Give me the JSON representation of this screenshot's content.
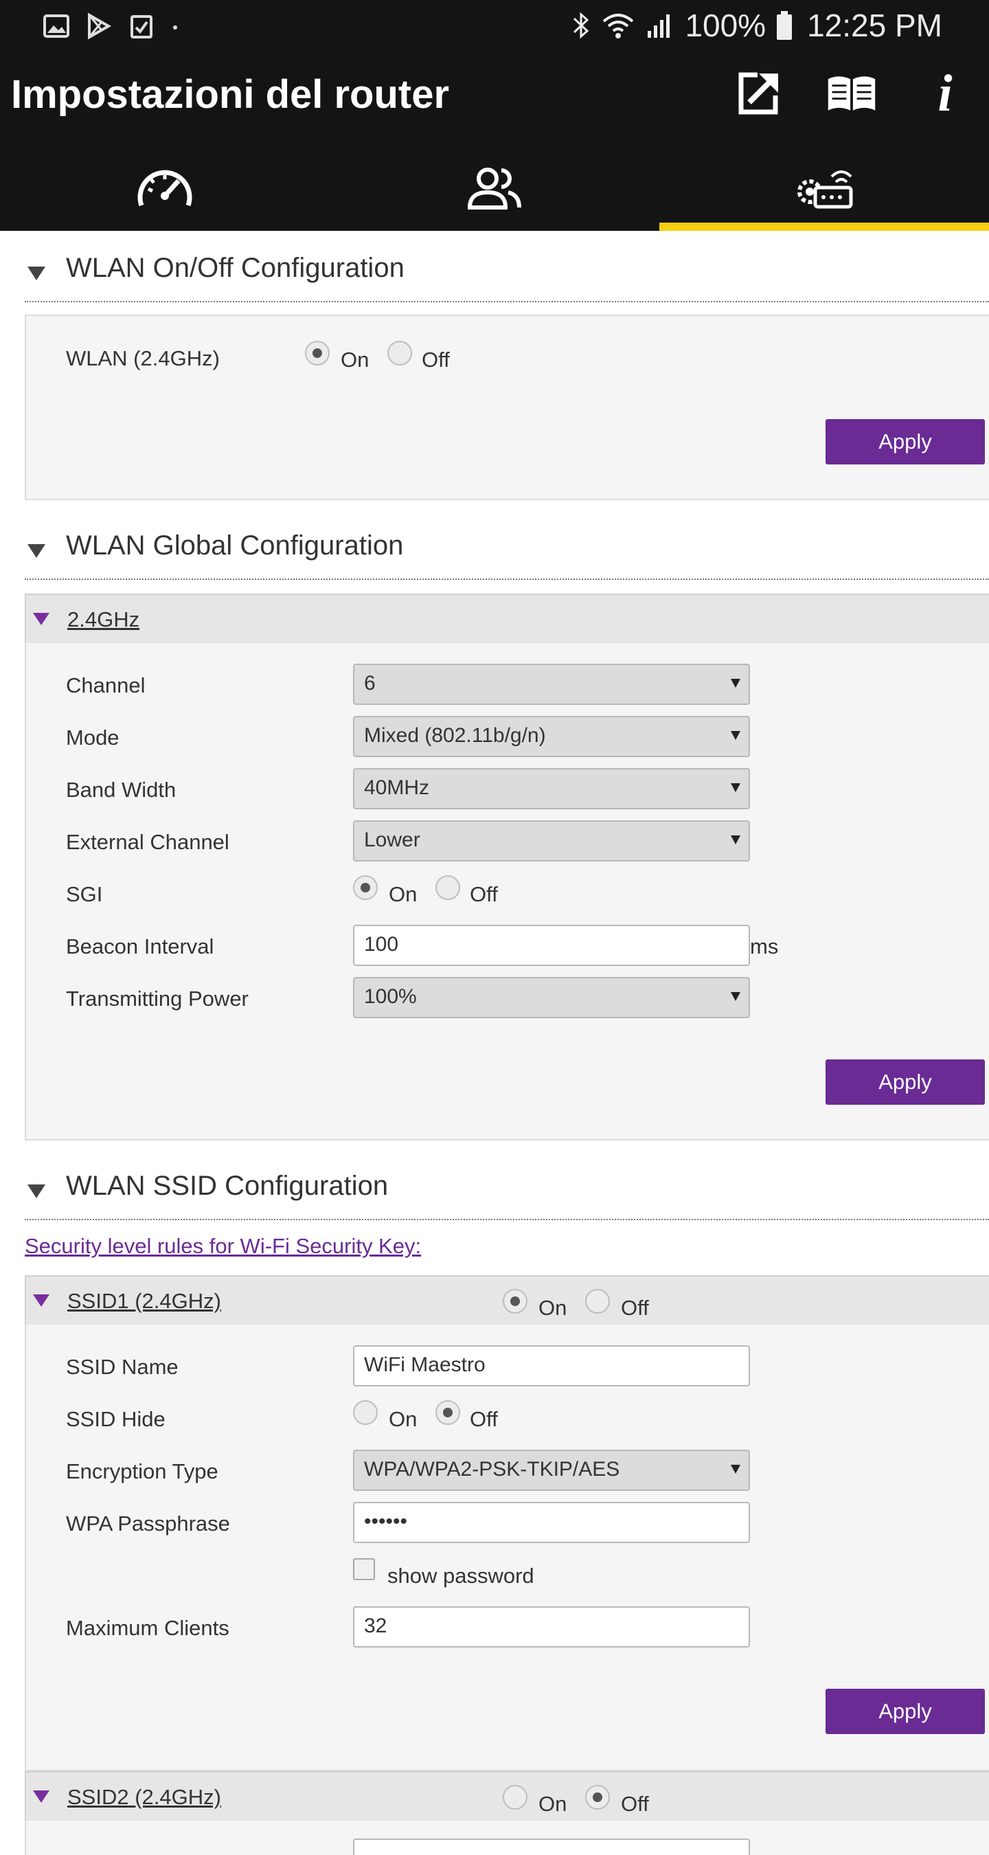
{
  "status_bar": {
    "battery_percent": "100%",
    "time": "12:25 PM"
  },
  "header": {
    "title": "Impostazioni del router",
    "icons": [
      "external-link-icon",
      "manual-book-icon",
      "info-icon"
    ],
    "info_label": "i"
  },
  "tabs": [
    {
      "name": "speedometer-icon",
      "active": false
    },
    {
      "name": "users-icon",
      "active": false
    },
    {
      "name": "router-settings-icon",
      "active": true
    }
  ],
  "accent_color": "#6a2b95",
  "tab_indicator_color": "#f5cf12",
  "wlan_onoff": {
    "title": "WLAN On/Off Configuration",
    "label": "WLAN (2.4GHz)",
    "on_label": "On",
    "off_label": "Off",
    "selected": "On",
    "apply": "Apply"
  },
  "wlan_global": {
    "title": "WLAN Global Configuration",
    "band": "2.4GHz",
    "channel_label": "Channel",
    "channel_value": "6",
    "mode_label": "Mode",
    "mode_value": "Mixed (802.11b/g/n)",
    "bandwidth_label": "Band Width",
    "bandwidth_value": "40MHz",
    "ext_channel_label": "External Channel",
    "ext_channel_value": "Lower",
    "sgi_label": "SGI",
    "sgi_on": "On",
    "sgi_off": "Off",
    "sgi_selected": "On",
    "beacon_label": "Beacon Interval",
    "beacon_value": "100",
    "beacon_unit": "ms",
    "power_label": "Transmitting Power",
    "power_value": "100%",
    "apply": "Apply"
  },
  "wlan_ssid": {
    "title": "WLAN SSID Configuration",
    "security_link": "Security level rules for Wi-Fi Security Key:",
    "ssid1": {
      "title": "SSID1 (2.4GHz)",
      "on_label": "On",
      "off_label": "Off",
      "selected": "On",
      "name_label": "SSID Name",
      "name_value": "WiFi Maestro",
      "hide_label": "SSID Hide",
      "hide_on": "On",
      "hide_off": "Off",
      "hide_selected": "Off",
      "enc_label": "Encryption Type",
      "enc_value": "WPA/WPA2-PSK-TKIP/AES",
      "pass_label": "WPA Passphrase",
      "pass_value": "••••••",
      "show_password": "show password",
      "max_label": "Maximum Clients",
      "max_value": "32",
      "apply": "Apply"
    },
    "ssid2": {
      "title": "SSID2 (2.4GHz)",
      "on_label": "On",
      "off_label": "Off",
      "selected": "Off"
    }
  }
}
